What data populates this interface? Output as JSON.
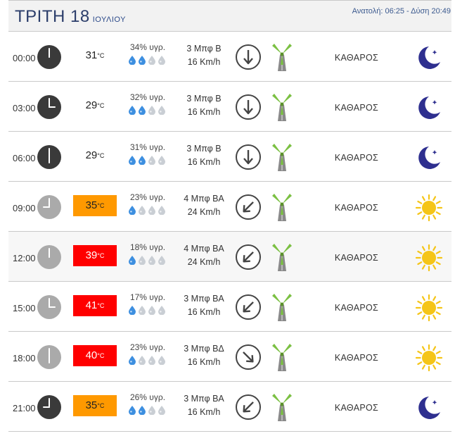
{
  "header": {
    "day": "ΤΡΙΤΗ 18",
    "month": "ΙΟΥΛΙΟΥ",
    "sun_text": "Ανατολή: 06:25 - Δύση 20:49"
  },
  "colors": {
    "warm": "#ff9900",
    "hot": "#ff0000",
    "drop_blue": "#3d8fe0",
    "drop_grey": "#c9ced4",
    "mill_green": "#7bc043",
    "moon": "#2e2f8f",
    "sun": "#f5c518"
  },
  "rows": [
    {
      "time": "00:00",
      "hour": 0,
      "clock": "dark",
      "temp": "31",
      "unit": "°C",
      "level": "normal",
      "humidity": "34% υγρ.",
      "drops_filled": 2,
      "wind_bft": "3 Μπφ Β",
      "wind_kmh": "16 Km/h",
      "dir_icon": "arrow-down-icon",
      "condition": "ΚΑΘΑΡΟΣ",
      "weather_icon": "moon-icon"
    },
    {
      "time": "03:00",
      "hour": 3,
      "clock": "dark",
      "temp": "29",
      "unit": "°C",
      "level": "normal",
      "humidity": "32% υγρ.",
      "drops_filled": 2,
      "wind_bft": "3 Μπφ Β",
      "wind_kmh": "16 Km/h",
      "dir_icon": "arrow-down-icon",
      "condition": "ΚΑΘΑΡΟΣ",
      "weather_icon": "moon-icon"
    },
    {
      "time": "06:00",
      "hour": 6,
      "clock": "dark",
      "temp": "29",
      "unit": "°C",
      "level": "normal",
      "humidity": "31% υγρ.",
      "drops_filled": 2,
      "wind_bft": "3 Μπφ Β",
      "wind_kmh": "16 Km/h",
      "dir_icon": "arrow-down-icon",
      "condition": "ΚΑΘΑΡΟΣ",
      "weather_icon": "moon-icon"
    },
    {
      "time": "09:00",
      "hour": 9,
      "clock": "light",
      "temp": "35",
      "unit": "°C",
      "level": "warm",
      "humidity": "23% υγρ.",
      "drops_filled": 1,
      "wind_bft": "4 Μπφ ΒΑ",
      "wind_kmh": "24 Km/h",
      "dir_icon": "arrow-down-left-icon",
      "condition": "ΚΑΘΑΡΟΣ",
      "weather_icon": "sun-icon"
    },
    {
      "time": "12:00",
      "hour": 12,
      "clock": "light",
      "temp": "39",
      "unit": "°C",
      "level": "hot",
      "humidity": "18% υγρ.",
      "drops_filled": 1,
      "wind_bft": "4 Μπφ ΒΑ",
      "wind_kmh": "24 Km/h",
      "dir_icon": "arrow-down-left-icon",
      "condition": "ΚΑΘΑΡΟΣ",
      "weather_icon": "sun-icon"
    },
    {
      "time": "15:00",
      "hour": 15,
      "clock": "light",
      "temp": "41",
      "unit": "°C",
      "level": "hot",
      "humidity": "17% υγρ.",
      "drops_filled": 1,
      "wind_bft": "3 Μπφ ΒΑ",
      "wind_kmh": "16 Km/h",
      "dir_icon": "arrow-down-left-icon",
      "condition": "ΚΑΘΑΡΟΣ",
      "weather_icon": "sun-icon"
    },
    {
      "time": "18:00",
      "hour": 18,
      "clock": "light",
      "temp": "40",
      "unit": "°C",
      "level": "hot",
      "humidity": "23% υγρ.",
      "drops_filled": 1,
      "wind_bft": "3 Μπφ ΒΔ",
      "wind_kmh": "16 Km/h",
      "dir_icon": "arrow-down-right-icon",
      "condition": "ΚΑΘΑΡΟΣ",
      "weather_icon": "sun-icon"
    },
    {
      "time": "21:00",
      "hour": 21,
      "clock": "dark",
      "temp": "35",
      "unit": "°C",
      "level": "warm",
      "humidity": "26% υγρ.",
      "drops_filled": 2,
      "wind_bft": "3 Μπφ ΒΑ",
      "wind_kmh": "16 Km/h",
      "dir_icon": "arrow-down-left-icon",
      "condition": "ΚΑΘΑΡΟΣ",
      "weather_icon": "moon-icon"
    }
  ]
}
